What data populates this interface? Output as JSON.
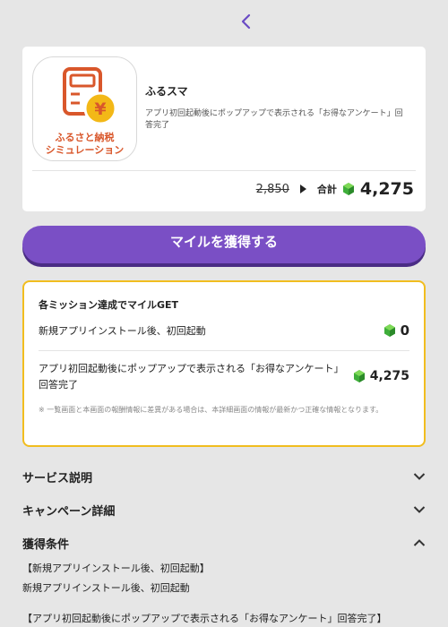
{
  "nav": {
    "back_icon": "chevron-left-icon",
    "accent": "#6a4bc4"
  },
  "offer": {
    "app_name": "ふるスマ",
    "logo_line1": "ふるさと納税",
    "logo_line2": "シミュレーション",
    "description": "アプリ初回起動後にポップアップで表示される「お得なアンケート」回答完了",
    "original_points": "2,850",
    "total_label": "合計",
    "total_points": "4,275"
  },
  "cta": {
    "label": "マイルを獲得する",
    "color": "#7a4fc5"
  },
  "missions": {
    "title": "各ミッション達成でマイルGET",
    "items": [
      {
        "label": "新規アプリインストール後、初回起動",
        "points": "0"
      },
      {
        "label": "アプリ初回起動後にポップアップで表示される「お得なアンケート」回答完了",
        "points": "4,275"
      }
    ],
    "note": "※ 一覧画面と本画面の報酬情報に差異がある場合は、本詳細画面の情報が最新かつ正確な情報となります。",
    "border_color": "#f1bd1f"
  },
  "sections": [
    {
      "title": "サービス説明",
      "state": "collapsed"
    },
    {
      "title": "キャンペーン詳細",
      "state": "collapsed"
    },
    {
      "title": "獲得条件",
      "state": "expanded"
    }
  ],
  "conditions": {
    "line1_heading": "【新規アプリインストール後、初回起動】",
    "line1_body": "新規アプリインストール後、初回起動",
    "line2_heading": "【アプリ初回起動後にポップアップで表示される「お得なアンケート」回答完了】"
  }
}
